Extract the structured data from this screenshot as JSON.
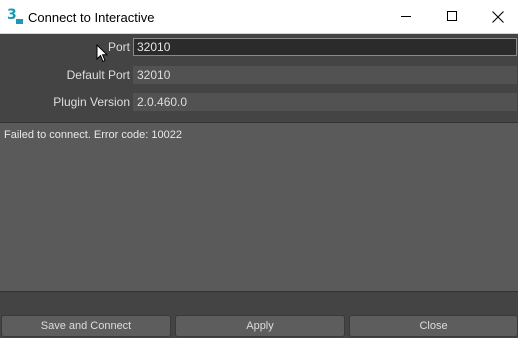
{
  "window": {
    "title": "Connect to Interactive",
    "icon": "3ds-max-app-icon",
    "icon_glyph": "3"
  },
  "form": {
    "port_label": "Port",
    "port_value": "32010",
    "default_port_label": "Default Port",
    "default_port_value": "32010",
    "plugin_version_label": "Plugin Version",
    "plugin_version_value": "2.0.460.0"
  },
  "log": {
    "message": "Failed to connect. Error code: 10022"
  },
  "buttons": {
    "save_connect": "Save and Connect",
    "apply": "Apply",
    "close": "Close"
  },
  "colors": {
    "background": "#444444",
    "titlebar": "#ffffff",
    "accent_icon": "#1b98b5"
  }
}
